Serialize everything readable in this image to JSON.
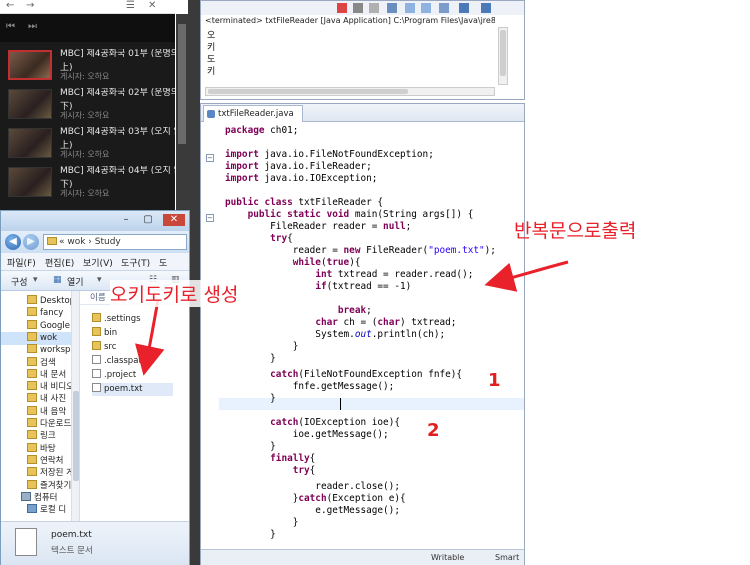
{
  "video_list": {
    "items": [
      {
        "title": "MBC] 제4공화국 01부 (운명의",
        "title2": "上)",
        "author": "게시자: 오하요"
      },
      {
        "title": "MBC] 제4공화국 02부 (운명의",
        "title2": "下)",
        "author": "게시자: 오하요"
      },
      {
        "title": "MBC] 제4공화국 03부 (오지 않",
        "title2": "上)",
        "author": "게시자: 오하요"
      },
      {
        "title": "MBC] 제4공화국 04부 (오지 않",
        "title2": "下)",
        "author": "게시자: 오하요"
      }
    ]
  },
  "explorer": {
    "address": "« wok › Study",
    "menu": [
      "파일(F)",
      "편집(E)",
      "보기(V)",
      "도구(T)",
      "도"
    ],
    "toolbar": {
      "organize": "구성",
      "open": "열기"
    },
    "column_header": "이름",
    "nav_items": [
      {
        "label": "Desktop",
        "icon": "folder"
      },
      {
        "label": "fancy",
        "icon": "folder"
      },
      {
        "label": "Google 2",
        "icon": "folder"
      },
      {
        "label": "wok",
        "icon": "folder",
        "selected": true
      },
      {
        "label": "workspa",
        "icon": "folder"
      },
      {
        "label": "검색",
        "icon": "folder"
      },
      {
        "label": "내 문서",
        "icon": "folder"
      },
      {
        "label": "내 비디오",
        "icon": "folder"
      },
      {
        "label": "내 사진",
        "icon": "folder"
      },
      {
        "label": "내 음악",
        "icon": "folder"
      },
      {
        "label": "다운로드",
        "icon": "folder"
      },
      {
        "label": "링크",
        "icon": "folder"
      },
      {
        "label": "바탕",
        "icon": "folder"
      },
      {
        "label": "연락처",
        "icon": "folder"
      },
      {
        "label": "저장된 게",
        "icon": "folder"
      },
      {
        "label": "즐겨찾기",
        "icon": "folder"
      },
      {
        "label": "컴퓨터",
        "icon": "comp"
      },
      {
        "label": "로컬 디",
        "icon": "lib"
      }
    ],
    "files": [
      {
        "name": ".settings",
        "type": "folder"
      },
      {
        "name": "bin",
        "type": "folder"
      },
      {
        "name": "src",
        "type": "folder"
      },
      {
        "name": ".classpath",
        "type": "file"
      },
      {
        "name": ".project",
        "type": "file"
      },
      {
        "name": "poem.txt",
        "type": "file",
        "selected": true
      }
    ],
    "details": {
      "name": "poem.txt",
      "type": "텍스트 문서"
    }
  },
  "console": {
    "status": "<terminated> txtFileReader [Java Application] C:\\Program Files\\Java\\jre8\\bin\\javaw.",
    "lines": [
      "오",
      "키",
      "도",
      "키"
    ]
  },
  "editor": {
    "tab_title": "txtFileReader.java",
    "status_writable": "Writable",
    "status_smart": "Smart"
  },
  "annotations": {
    "loop_output": "반복문으로출력",
    "okidoki_generate": "오키도키로 생성",
    "label_1": "1",
    "label_2": "2",
    "color": "#e8212b"
  }
}
